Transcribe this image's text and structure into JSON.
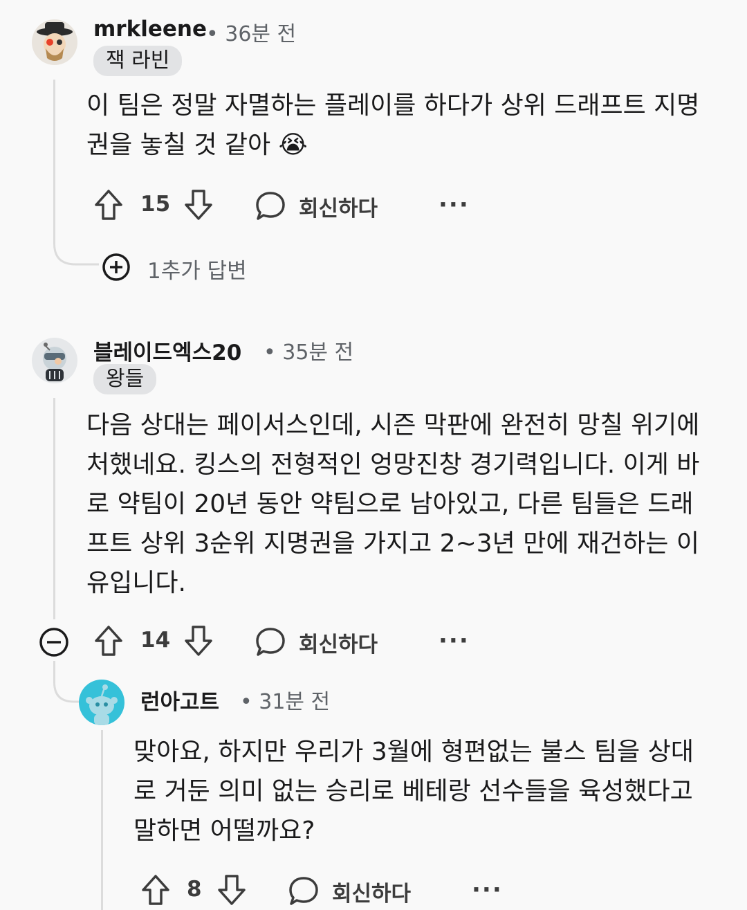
{
  "comments": [
    {
      "username": "mrkleene",
      "time": "• 36분 전",
      "flair": "잭 라빈",
      "body": "이 팀은 정말 자멸하는 플레이를 하다가 상위 드래프트 지명권을 놓칠 것 같아 😭",
      "votes": "15",
      "reply_label": "회신하다",
      "more_label": "···",
      "expand_label": "1추가 답변"
    },
    {
      "username": "블레이드엑스20",
      "time": "• 35분 전",
      "flair": "왕들",
      "body": "다음 상대는 페이서스인데, 시즌 막판에 완전히 망칠 위기에 처했네요. 킹스의 전형적인 엉망진창 경기력입니다. 이게 바로 약팀이 20년 동안 약팀으로 남아있고, 다른 팀들은 드래프트 상위 3순위 지명권을 가지고 2~3년 만에 재건하는 이유입니다.",
      "votes": "14",
      "reply_label": "회신하다",
      "more_label": "···"
    },
    {
      "username": "런아고트",
      "time": "• 31분 전",
      "body": "맞아요, 하지만 우리가 3월에 형편없는 불스 팀을 상대로 거둔 의미 없는 승리로 베테랑 선수들을 육성했다고 말하면 어떨까요?",
      "votes": "8",
      "reply_label": "회신하다",
      "more_label": "···"
    }
  ]
}
